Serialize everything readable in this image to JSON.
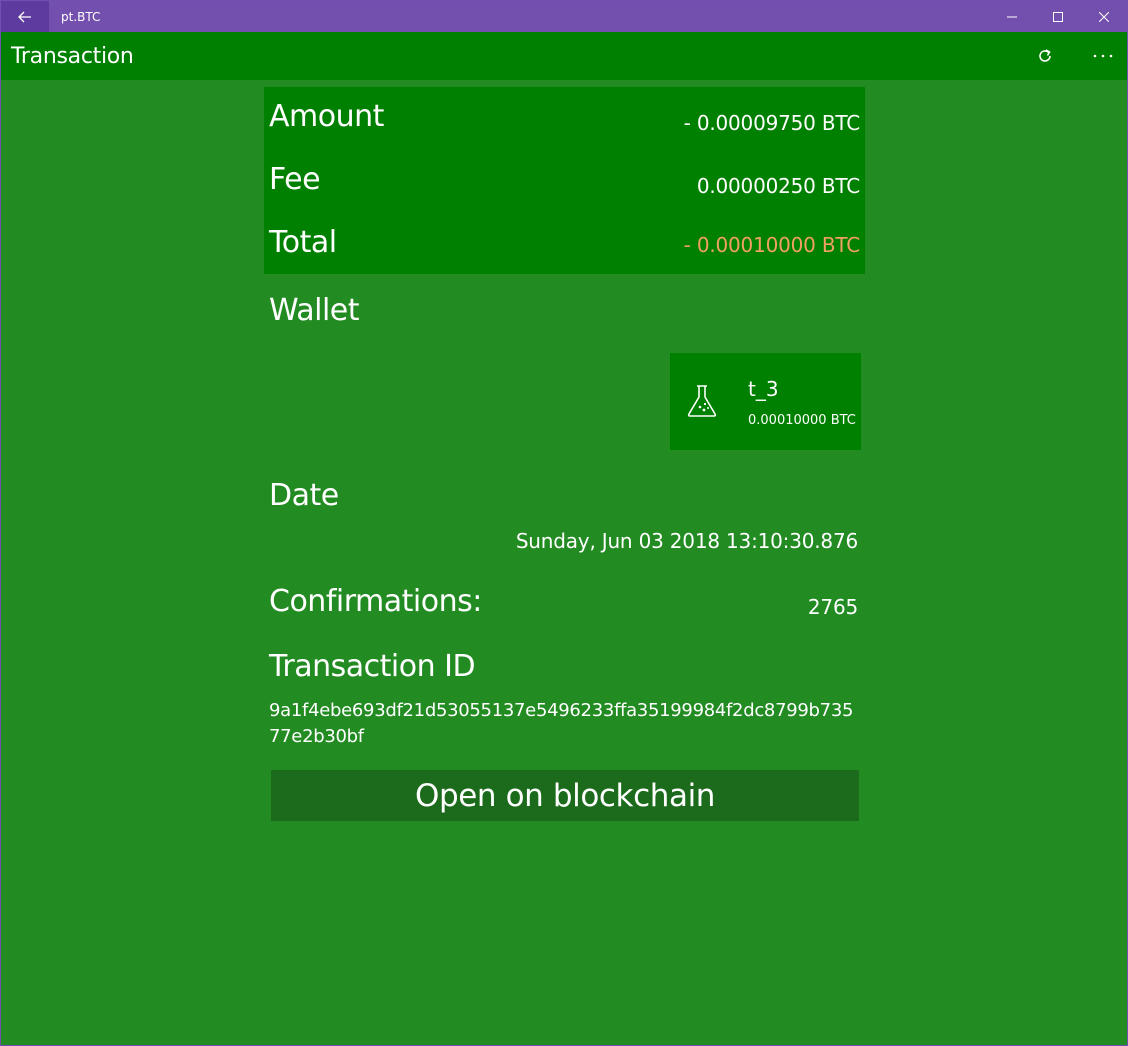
{
  "window": {
    "title": "pt.BTC",
    "controls": [
      "minimize-icon",
      "maximize-icon",
      "close-icon"
    ]
  },
  "appbar": {
    "title": "Transaction",
    "actions": [
      "refresh-icon",
      "more-icon"
    ]
  },
  "summary": {
    "amount_label": "Amount",
    "amount_value": "- 0.00009750 BTC",
    "fee_label": "Fee",
    "fee_value": "0.00000250 BTC",
    "total_label": "Total",
    "total_value": "- 0.00010000 BTC",
    "total_color": "#F0A060"
  },
  "wallet": {
    "label": "Wallet",
    "name": "t_3",
    "balance": "0.00010000 BTC",
    "icon": "flask-icon"
  },
  "date": {
    "label": "Date",
    "value": "Sunday, Jun 03 2018 13:10:30.876"
  },
  "confirmations": {
    "label": "Confirmations:",
    "value": "2765"
  },
  "transaction_id": {
    "label": "Transaction ID",
    "value": "9a1f4ebe693df21d53055137e5496233ffa35199984f2dc8799b73577e2b30bf"
  },
  "actions": {
    "open_blockchain": "Open on blockchain"
  },
  "colors": {
    "titlebar": "#7450AE",
    "appbar": "#008000",
    "background": "#228B22",
    "button": "#1C6B1C"
  }
}
